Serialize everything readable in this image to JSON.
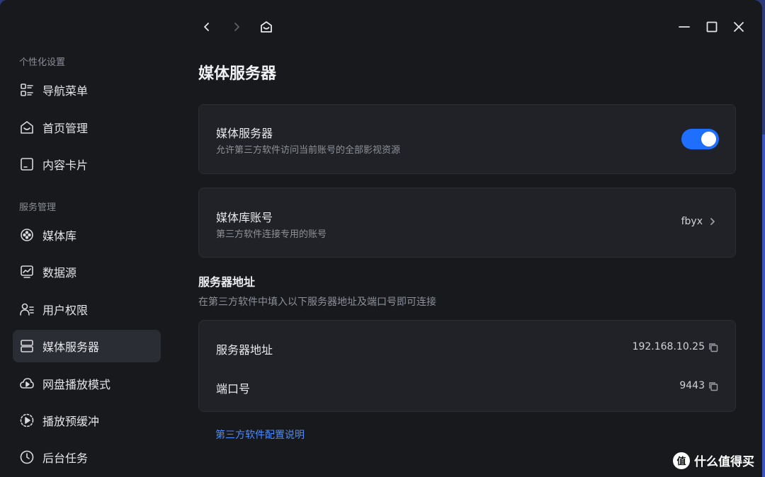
{
  "sidebar": {
    "section1_title": "个性化设置",
    "section2_title": "服务管理",
    "items": [
      {
        "label": "导航菜单",
        "icon": "list-icon"
      },
      {
        "label": "首页管理",
        "icon": "home-icon"
      },
      {
        "label": "内容卡片",
        "icon": "card-icon"
      },
      {
        "label": "媒体库",
        "icon": "media-library-icon"
      },
      {
        "label": "数据源",
        "icon": "chart-icon"
      },
      {
        "label": "用户权限",
        "icon": "users-icon"
      },
      {
        "label": "媒体服务器",
        "icon": "server-icon"
      },
      {
        "label": "网盘播放模式",
        "icon": "cloud-play-icon"
      },
      {
        "label": "播放预缓冲",
        "icon": "buffer-icon"
      },
      {
        "label": "后台任务",
        "icon": "clock-icon"
      }
    ],
    "active_index": 6
  },
  "page": {
    "title": "媒体服务器",
    "server_card": {
      "title": "媒体服务器",
      "desc": "允许第三方软件访问当前账号的全部影视资源",
      "enabled": true
    },
    "account_card": {
      "title": "媒体库账号",
      "desc": "第三方软件连接专用的账号",
      "value": "fbyx"
    },
    "address_section": {
      "heading": "服务器地址",
      "desc": "在第三方软件中填入以下服务器地址及端口号即可连接"
    },
    "address_rows": [
      {
        "label": "服务器地址",
        "value": "192.168.10.25"
      },
      {
        "label": "端口号",
        "value": "9443"
      }
    ],
    "help_link": "第三方软件配置说明"
  },
  "watermark": {
    "logo": "值",
    "text": "什么值得买"
  },
  "colors": {
    "accent": "#1f6fff",
    "link": "#4b8cff",
    "background": "#17191d",
    "card": "#202227"
  }
}
